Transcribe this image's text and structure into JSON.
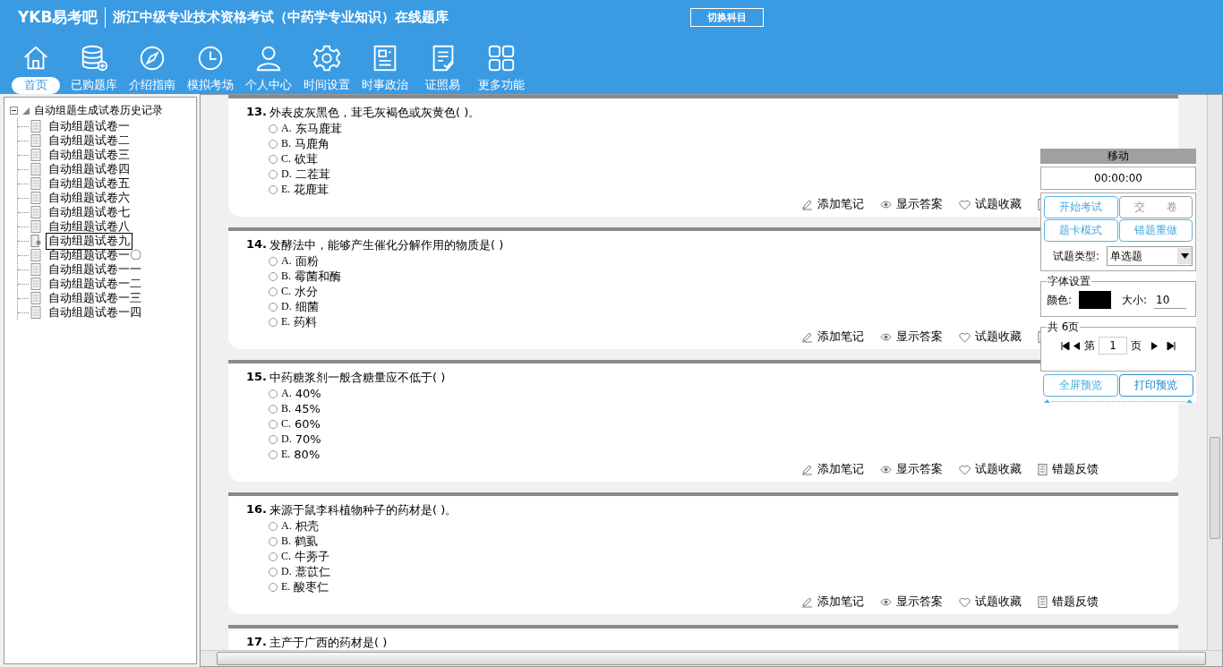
{
  "header": {
    "logo": "YKB易考吧",
    "title": "浙江中级专业技术资格考试（中药学专业知识）在线题库",
    "switch_button": "切换科目"
  },
  "nav": [
    {
      "label": "首页",
      "kind": "home",
      "selected": true
    },
    {
      "label": "已购题库",
      "kind": "database",
      "selected": false
    },
    {
      "label": "介绍指南",
      "kind": "compass",
      "selected": false
    },
    {
      "label": "模拟考场",
      "kind": "clock",
      "selected": false
    },
    {
      "label": "个人中心",
      "kind": "user",
      "selected": false
    },
    {
      "label": "时间设置",
      "kind": "gear",
      "selected": false
    },
    {
      "label": "时事政治",
      "kind": "news",
      "selected": false
    },
    {
      "label": "证照易",
      "kind": "checklist",
      "selected": false
    },
    {
      "label": "更多功能",
      "kind": "grid",
      "selected": false
    }
  ],
  "tree": {
    "root": "自动组题生成试卷历史记录",
    "expanded": true,
    "children": [
      {
        "label": "自动组题试卷一",
        "selected": false
      },
      {
        "label": "自动组题试卷二",
        "selected": false
      },
      {
        "label": "自动组题试卷三",
        "selected": false
      },
      {
        "label": "自动组题试卷四",
        "selected": false
      },
      {
        "label": "自动组题试卷五",
        "selected": false
      },
      {
        "label": "自动组题试卷六",
        "selected": false
      },
      {
        "label": "自动组题试卷七",
        "selected": false
      },
      {
        "label": "自动组题试卷八",
        "selected": false
      },
      {
        "label": "自动组题试卷九",
        "selected": true
      },
      {
        "label": "自动组题试卷一〇",
        "selected": false
      },
      {
        "label": "自动组题试卷一一",
        "selected": false
      },
      {
        "label": "自动组题试卷一二",
        "selected": false
      },
      {
        "label": "自动组题试卷一三",
        "selected": false
      },
      {
        "label": "自动组题试卷一四",
        "selected": false
      }
    ]
  },
  "questions": [
    {
      "number": "13.",
      "text": "外表皮灰黑色，茸毛灰褐色或灰黄色( )。",
      "options": [
        {
          "letter": "A.",
          "text": "东马鹿茸",
          "selected": false
        },
        {
          "letter": "B.",
          "text": "马鹿角",
          "selected": false
        },
        {
          "letter": "C.",
          "text": "砍茸",
          "selected": false
        },
        {
          "letter": "D.",
          "text": "二茬茸",
          "selected": false
        },
        {
          "letter": "E.",
          "text": "花鹿茸",
          "selected": false
        }
      ],
      "actions": [
        {
          "kind": "note",
          "label": "添加笔记"
        },
        {
          "kind": "answer",
          "label": "显示答案"
        },
        {
          "kind": "favorite",
          "label": "试题收藏"
        },
        {
          "kind": "feedback"
        }
      ]
    },
    {
      "number": "14.",
      "text": "发酵法中，能够产生催化分解作用的物质是( )",
      "options": [
        {
          "letter": "A.",
          "text": "面粉",
          "selected": false
        },
        {
          "letter": "B.",
          "text": "霉菌和酶",
          "selected": false
        },
        {
          "letter": "C.",
          "text": "水分",
          "selected": false
        },
        {
          "letter": "D.",
          "text": "细菌",
          "selected": false
        },
        {
          "letter": "E.",
          "text": "药料",
          "selected": false
        }
      ],
      "actions": [
        {
          "kind": "note",
          "label": "添加笔记"
        },
        {
          "kind": "answer",
          "label": "显示答案"
        },
        {
          "kind": "favorite",
          "label": "试题收藏"
        },
        {
          "kind": "feedback"
        }
      ]
    },
    {
      "number": "15.",
      "text": "中药糖浆剂一般含糖量应不低于( )",
      "options": [
        {
          "letter": "A.",
          "text": "40%",
          "selected": false
        },
        {
          "letter": "B.",
          "text": "45%",
          "selected": false
        },
        {
          "letter": "C.",
          "text": "60%",
          "selected": false
        },
        {
          "letter": "D.",
          "text": "70%",
          "selected": false
        },
        {
          "letter": "E.",
          "text": "80%",
          "selected": false
        }
      ],
      "actions": [
        {
          "kind": "note",
          "label": "添加笔记"
        },
        {
          "kind": "answer",
          "label": "显示答案"
        },
        {
          "kind": "favorite",
          "label": "试题收藏"
        },
        {
          "kind": "feedback",
          "label": "错题反馈"
        }
      ]
    },
    {
      "number": "16.",
      "text": "来源于鼠李科植物种子的药材是( )。",
      "options": [
        {
          "letter": "A.",
          "text": "枳壳",
          "selected": false
        },
        {
          "letter": "B.",
          "text": "鹤虱",
          "selected": false
        },
        {
          "letter": "C.",
          "text": "牛蒡子",
          "selected": false
        },
        {
          "letter": "D.",
          "text": "薏苡仁",
          "selected": false
        },
        {
          "letter": "E.",
          "text": "酸枣仁",
          "selected": false
        }
      ],
      "actions": [
        {
          "kind": "note",
          "label": "添加笔记"
        },
        {
          "kind": "answer",
          "label": "显示答案"
        },
        {
          "kind": "favorite",
          "label": "试题收藏"
        },
        {
          "kind": "feedback",
          "label": "错题反馈"
        }
      ]
    },
    {
      "number": "17.",
      "text": "主产于广西的药材是( )"
    }
  ],
  "panel": {
    "title": "移动",
    "timer": "00:00:00",
    "buttons": [
      {
        "label": "开始考试",
        "disabled": false
      },
      {
        "label": "交　　卷",
        "disabled": true
      },
      {
        "label": "题卡模式",
        "disabled": false
      },
      {
        "label": "错题重做",
        "disabled": false
      }
    ],
    "type_label": "试题类型:",
    "type_value": "单选题",
    "font_settings": {
      "legend": "字体设置",
      "color_label": "颜色:",
      "color": "#000000",
      "size_label": "大小:",
      "size": "10"
    },
    "pager": {
      "legend": "共 6页",
      "prefix": "第",
      "page": "1",
      "suffix": "页"
    },
    "bottom_buttons": [
      {
        "label": "全屏预览",
        "selected": false
      },
      {
        "label": "打印预览",
        "selected": true
      }
    ]
  }
}
